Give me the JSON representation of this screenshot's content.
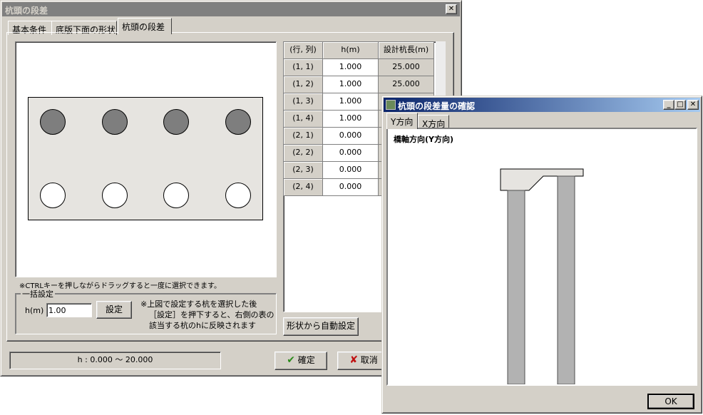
{
  "main_dialog": {
    "title": "杭頭の段差",
    "close_symbol": "✕",
    "tabs": [
      {
        "label": "基本条件"
      },
      {
        "label": "底版下面の形状"
      },
      {
        "label": "杭頭の段差",
        "active": true
      }
    ],
    "note": "※CTRLキーを押しながらドラッグすると一度に選択できます。",
    "group": {
      "title": "一括設定",
      "h_label": "h(m)",
      "h_value": "1.00",
      "set_button": "設定",
      "instructions": [
        "※上図で設定する杭を選択した後",
        "［設定］を押下すると、右側の表の",
        "該当する杭のhに反映されます"
      ]
    },
    "table": {
      "headers": [
        "(行, 列)",
        "h(m)",
        "設計杭長(m)"
      ],
      "rows": [
        {
          "pos": "(1, 1)",
          "h": "1.000",
          "length": "25.000"
        },
        {
          "pos": "(1, 2)",
          "h": "1.000",
          "length": "25.000"
        },
        {
          "pos": "(1, 3)",
          "h": "1.000",
          "length": ""
        },
        {
          "pos": "(1, 4)",
          "h": "1.000",
          "length": ""
        },
        {
          "pos": "(2, 1)",
          "h": "0.000",
          "length": ""
        },
        {
          "pos": "(2, 2)",
          "h": "0.000",
          "length": ""
        },
        {
          "pos": "(2, 3)",
          "h": "0.000",
          "length": ""
        },
        {
          "pos": "(2, 4)",
          "h": "0.000",
          "length": ""
        }
      ]
    },
    "auto_button": "形状から自動設定",
    "range_text": "h : 0.000 ～ 20.000",
    "ok_button": "確定",
    "cancel_button": "取消",
    "colors": {
      "selected_pile": "#7e7e7e",
      "unselected_pile": "#ffffff",
      "ok_icon": "#2a8a1a",
      "cancel_icon": "#c01010"
    }
  },
  "sub_dialog": {
    "title": "杭頭の段差量の確認",
    "minimize_symbol": "_",
    "maximize_symbol": "□",
    "close_symbol": "✕",
    "tabs": [
      {
        "label": "Y方向",
        "active": true
      },
      {
        "label": "X方向"
      }
    ],
    "view_title": "橋軸方向(Y方向)",
    "ok_button": "OK"
  }
}
